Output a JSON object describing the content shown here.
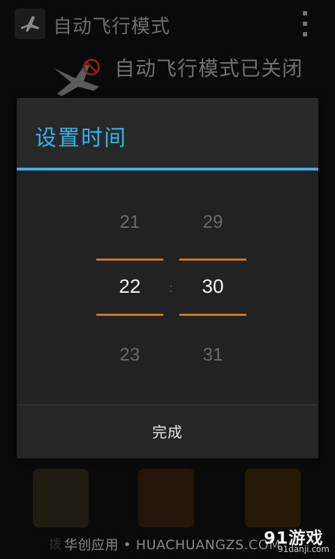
{
  "app": {
    "title": "自动飞行模式",
    "status_text": "自动飞行模式已关闭",
    "icon": "airplane-icon",
    "menu_icon": "overflow-menu-icon"
  },
  "dialog": {
    "title": "设置时间",
    "hours": {
      "prev": "21",
      "current": "22",
      "next": "23"
    },
    "separator": ":",
    "minutes": {
      "prev": "29",
      "current": "30",
      "next": "31"
    },
    "done_label": "完成"
  },
  "dock": {
    "label_partial": "拨"
  },
  "watermark": {
    "text": "华创应用 • HUACHUANGZS.COM",
    "brand_logo": "91游戏",
    "brand_url": "91danji.com"
  },
  "colors": {
    "accent": "#33b5e5",
    "selection_line": "#c97c2a",
    "dialog_bg": "#262626"
  }
}
